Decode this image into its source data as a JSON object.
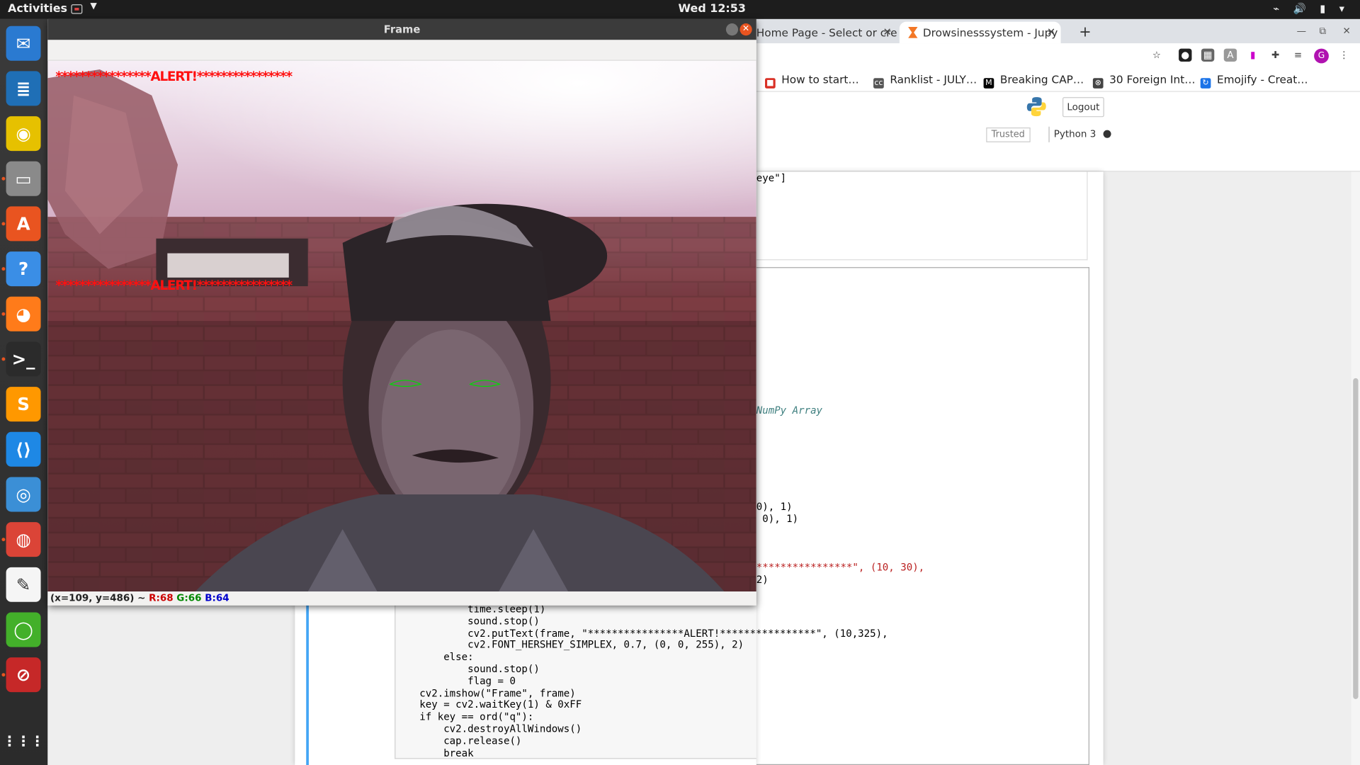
{
  "topbar": {
    "activities": "Activities",
    "clock": "Wed 12:53",
    "tray": "⌁ 🔊 ▮ ▾"
  },
  "dock": {
    "items": [
      {
        "name": "thunderbird-icon",
        "glyph": "✉",
        "color": "#2a7ad1"
      },
      {
        "name": "writer-icon",
        "glyph": "≣",
        "color": "#1f6fb6"
      },
      {
        "name": "rhythmbox-icon",
        "glyph": "◉",
        "color": "#e6c100"
      },
      {
        "name": "files-icon",
        "glyph": "▭",
        "color": "#8a8a8a"
      },
      {
        "name": "software-icon",
        "glyph": "A",
        "color": "#e95420"
      },
      {
        "name": "help-icon",
        "glyph": "?",
        "color": "#3a8ee6"
      },
      {
        "name": "firefox-icon",
        "glyph": "◕",
        "color": "#ff7b1a"
      },
      {
        "name": "terminal-icon",
        "glyph": ">_",
        "color": "#2b2b2b"
      },
      {
        "name": "sublime-icon",
        "glyph": "S",
        "color": "#ff9800"
      },
      {
        "name": "vscode-icon",
        "glyph": "⟨⟩",
        "color": "#1e88e5"
      },
      {
        "name": "ubuntu-icon",
        "glyph": "◎",
        "color": "#3b8fd6"
      },
      {
        "name": "chrome-icon",
        "glyph": "◍",
        "color": "#db4437"
      },
      {
        "name": "text-editor-icon",
        "glyph": "✎",
        "color": "#f5f5f5"
      },
      {
        "name": "anaconda-icon",
        "glyph": "◯",
        "color": "#43b02a"
      },
      {
        "name": "frame-app-icon",
        "glyph": "⊘",
        "color": "#c62828"
      }
    ],
    "show_apps": "⋮⋮⋮"
  },
  "chrome": {
    "tabs": [
      {
        "label": "Home Page - Select or cre",
        "active": false
      },
      {
        "label": "Drowsinesssystem - Jupy",
        "active": true
      }
    ],
    "new_tab": "+",
    "bookmarks": [
      {
        "label": "How to start…",
        "color": "#d93025",
        "glyph": "■"
      },
      {
        "label": "Ranklist - JULY…",
        "color": "#555555",
        "glyph": "cc"
      },
      {
        "label": "Breaking CAP…",
        "color": "#000000",
        "glyph": "M"
      },
      {
        "label": "30 Foreign Int…",
        "color": "#444444",
        "glyph": "⊗"
      },
      {
        "label": "Emojify - Creat…",
        "color": "#1a73e8",
        "glyph": "↻"
      }
    ],
    "avatar": "G"
  },
  "jupyter": {
    "logout": "Logout",
    "trusted": "Trusted",
    "kernel": "Python 3",
    "cell1_code": "eye\"]",
    "code_lines": [
      {
        "text": "NumPy Array",
        "color": "#408080",
        "italic": true
      },
      {
        "text": "0), 1)",
        "color": "#000"
      },
      {
        "text": " 0), 1)",
        "color": "#000"
      },
      {
        "text": "****************\", (10, 30),",
        "color": "#ba2121"
      },
      {
        "text": "2)",
        "color": "#000"
      }
    ]
  },
  "notebook_bottom": {
    "lines": [
      "            time.sleep(1)",
      "            sound.stop()",
      "            cv2.putText(frame, \"****************ALERT!****************\", (10,325),",
      "            cv2.FONT_HERSHEY_SIMPLEX, 0.7, (0, 0, 255), 2)",
      "        else:",
      "            sound.stop()",
      "            flag = 0",
      "    cv2.imshow(\"Frame\", frame)",
      "    key = cv2.waitKey(1) & 0xFF",
      "    if key == ord(\"q\"):",
      "        cv2.destroyAllWindows()",
      "        cap.release()",
      "        break"
    ]
  },
  "frame_window": {
    "title": "Frame",
    "alert_text": "****************ALERT!****************",
    "status": {
      "coords": "(x=109, y=486) ~ ",
      "r": "R:68",
      "g": "G:66",
      "b": "B:64"
    }
  }
}
